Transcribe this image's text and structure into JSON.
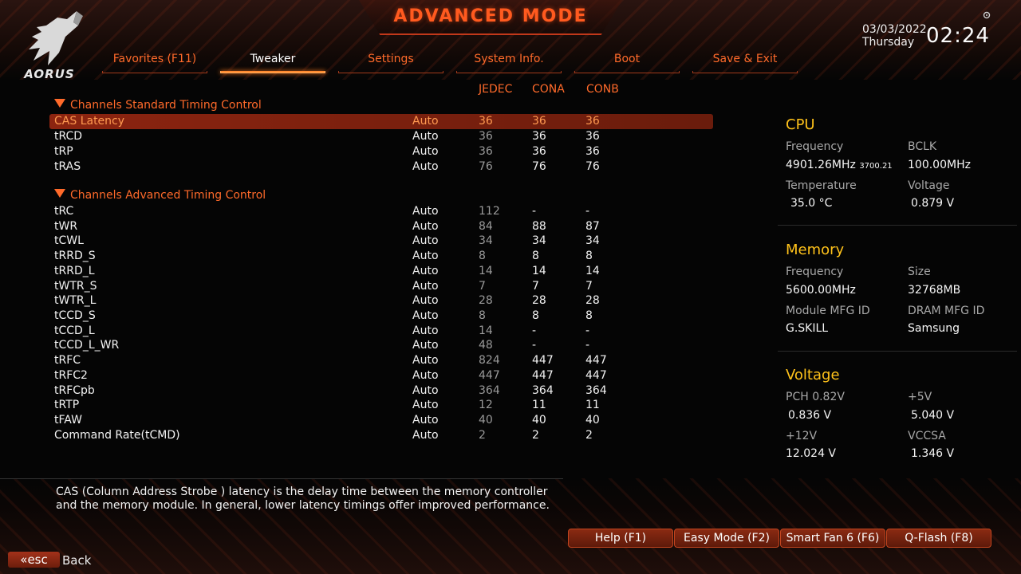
{
  "header": {
    "title": "ADVANCED MODE",
    "brand": "AORUS",
    "date": "03/03/2022",
    "day": "Thursday",
    "time": "02:24"
  },
  "tabs": [
    {
      "label": "Favorites (F11)",
      "active": false
    },
    {
      "label": "Tweaker",
      "active": true
    },
    {
      "label": "Settings",
      "active": false
    },
    {
      "label": "System Info.",
      "active": false
    },
    {
      "label": "Boot",
      "active": false
    },
    {
      "label": "Save & Exit",
      "active": false
    }
  ],
  "columns": {
    "jedec": "JEDEC",
    "cona": "CONA",
    "conb": "CONB"
  },
  "sections": {
    "standard": "Channels Standard Timing Control",
    "advanced": "Channels Advanced Timing Control"
  },
  "standard_rows": [
    {
      "name": "CAS Latency",
      "mode": "Auto",
      "jedec": "36",
      "cona": "36",
      "conb": "36"
    },
    {
      "name": "tRCD",
      "mode": "Auto",
      "jedec": "36",
      "cona": "36",
      "conb": "36"
    },
    {
      "name": "tRP",
      "mode": "Auto",
      "jedec": "36",
      "cona": "36",
      "conb": "36"
    },
    {
      "name": "tRAS",
      "mode": "Auto",
      "jedec": "76",
      "cona": "76",
      "conb": "76"
    }
  ],
  "advanced_rows": [
    {
      "name": "tRC",
      "mode": "Auto",
      "jedec": "112",
      "cona": "-",
      "conb": "-"
    },
    {
      "name": "tWR",
      "mode": "Auto",
      "jedec": "84",
      "cona": "88",
      "conb": "87"
    },
    {
      "name": "tCWL",
      "mode": "Auto",
      "jedec": "34",
      "cona": "34",
      "conb": "34"
    },
    {
      "name": "tRRD_S",
      "mode": "Auto",
      "jedec": "8",
      "cona": "8",
      "conb": "8"
    },
    {
      "name": "tRRD_L",
      "mode": "Auto",
      "jedec": "14",
      "cona": "14",
      "conb": "14"
    },
    {
      "name": "tWTR_S",
      "mode": "Auto",
      "jedec": "7",
      "cona": "7",
      "conb": "7"
    },
    {
      "name": "tWTR_L",
      "mode": "Auto",
      "jedec": "28",
      "cona": "28",
      "conb": "28"
    },
    {
      "name": "tCCD_S",
      "mode": "Auto",
      "jedec": "8",
      "cona": "8",
      "conb": "8"
    },
    {
      "name": "tCCD_L",
      "mode": "Auto",
      "jedec": "14",
      "cona": "-",
      "conb": "-"
    },
    {
      "name": "tCCD_L_WR",
      "mode": "Auto",
      "jedec": "48",
      "cona": "-",
      "conb": "-"
    },
    {
      "name": "tRFC",
      "mode": "Auto",
      "jedec": "824",
      "cona": "447",
      "conb": "447"
    },
    {
      "name": "tRFC2",
      "mode": "Auto",
      "jedec": "447",
      "cona": "447",
      "conb": "447"
    },
    {
      "name": "tRFCpb",
      "mode": "Auto",
      "jedec": "364",
      "cona": "364",
      "conb": "364"
    },
    {
      "name": "tRTP",
      "mode": "Auto",
      "jedec": "12",
      "cona": "11",
      "conb": "11"
    },
    {
      "name": "tFAW",
      "mode": "Auto",
      "jedec": "40",
      "cona": "40",
      "conb": "40"
    },
    {
      "name": "Command Rate(tCMD)",
      "mode": "Auto",
      "jedec": "2",
      "cona": "2",
      "conb": "2"
    }
  ],
  "cpu": {
    "title": "CPU",
    "freq_label": "Frequency",
    "freq_value": "4901.26MHz",
    "freq_sub": "3700.21",
    "bclk_label": "BCLK",
    "bclk_value": "100.00MHz",
    "temp_label": "Temperature",
    "temp_value": "35.0 °C",
    "volt_label": "Voltage",
    "volt_value": "0.879 V"
  },
  "memory": {
    "title": "Memory",
    "freq_label": "Frequency",
    "freq_value": "5600.00MHz",
    "size_label": "Size",
    "size_value": "32768MB",
    "module_label": "Module MFG ID",
    "module_value": "G.SKILL",
    "dram_label": "DRAM MFG ID",
    "dram_value": "Samsung"
  },
  "voltage": {
    "title": "Voltage",
    "pch_label": "PCH 0.82V",
    "pch_value": "0.836 V",
    "p5_label": "+5V",
    "p5_value": "5.040 V",
    "p12_label": "+12V",
    "p12_value": "12.024 V",
    "vccsa_label": "VCCSA",
    "vccsa_value": "1.346 V"
  },
  "description": {
    "line1": "CAS (Column Address Strobe ) latency is the delay time between the memory controller",
    "line2": "and the memory module. In general, lower latency timings offer improved performance."
  },
  "buttons": {
    "help": "Help (F1)",
    "easy": "Easy Mode (F2)",
    "smartfan": "Smart Fan 6 (F6)",
    "qflash": "Q-Flash (F8)",
    "esc": "esc",
    "back": "Back"
  },
  "colors": {
    "accent": "#ff6a2a",
    "panel_title": "#ffc21a",
    "selected_row": "#8c2410"
  }
}
